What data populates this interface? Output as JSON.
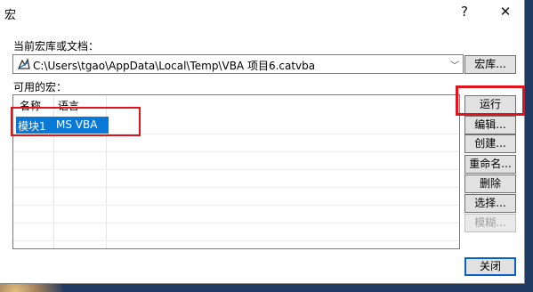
{
  "window": {
    "title": "宏",
    "help_glyph": "?",
    "close_glyph": "✕"
  },
  "macro_source": {
    "label": "当前宏库或文档：",
    "value": "C:\\Users\\tgao\\AppData\\Local\\Temp\\VBA 项目6.catvba",
    "icon": "catvba-document-icon"
  },
  "macro_list": {
    "label": "可用的宏：",
    "columns": [
      "名称",
      "语言"
    ],
    "rows": [
      {
        "name": "模块1",
        "language": "MS VBA",
        "selected": true
      }
    ]
  },
  "buttons": {
    "macro_library": "宏库...",
    "run": "运行",
    "edit": "编辑...",
    "create": "创建...",
    "rename": "重命名...",
    "delete": "删除",
    "select": "选择...",
    "template": "模糊...",
    "close": "关闭"
  },
  "colors": {
    "selection": "#0a78d7",
    "highlight_annotation": "#e0141c",
    "desktop_background": "#1f3b64"
  }
}
